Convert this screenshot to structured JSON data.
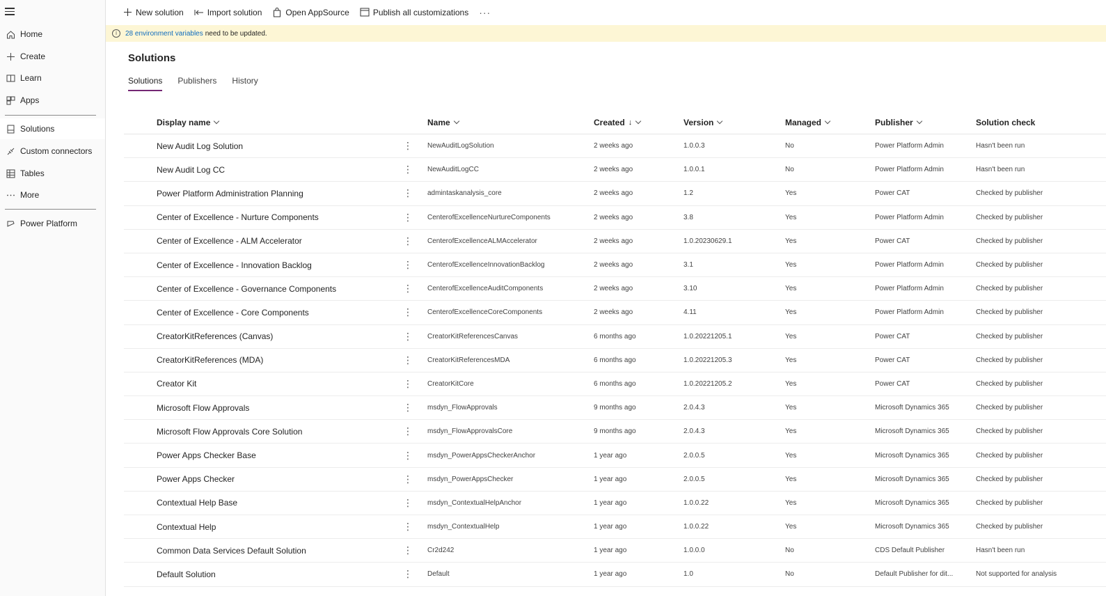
{
  "sidebar": {
    "items": [
      {
        "label": "Home",
        "icon": "home-icon"
      },
      {
        "label": "Create",
        "icon": "plus-icon"
      },
      {
        "label": "Learn",
        "icon": "book-icon"
      },
      {
        "label": "Apps",
        "icon": "apps-icon"
      },
      {
        "label": "Solutions",
        "icon": "solutions-icon"
      },
      {
        "label": "Custom connectors",
        "icon": "connector-icon"
      },
      {
        "label": "Tables",
        "icon": "table-icon"
      },
      {
        "label": "More",
        "icon": "more-icon"
      },
      {
        "label": "Power Platform",
        "icon": "power-platform-icon"
      }
    ],
    "active": "Solutions"
  },
  "commands": {
    "new_solution": "New solution",
    "import_solution": "Import solution",
    "open_appsource": "Open AppSource",
    "publish_all": "Publish all customizations",
    "more": "···"
  },
  "banner": {
    "link": "28 environment variables",
    "text": "need to be updated."
  },
  "page": {
    "title": "Solutions",
    "tabs": [
      "Solutions",
      "Publishers",
      "History"
    ]
  },
  "grid": {
    "headers": {
      "display_name": "Display name",
      "name": "Name",
      "created": "Created",
      "version": "Version",
      "managed": "Managed",
      "publisher": "Publisher",
      "solution_check": "Solution check"
    },
    "rows": [
      {
        "display": "New Audit Log Solution",
        "name": "NewAuditLogSolution",
        "created": "2 weeks ago",
        "version": "1.0.0.3",
        "managed": "No",
        "publisher": "Power Platform Admin",
        "check": "Hasn't been run"
      },
      {
        "display": "New Audit Log CC",
        "name": "NewAuditLogCC",
        "created": "2 weeks ago",
        "version": "1.0.0.1",
        "managed": "No",
        "publisher": "Power Platform Admin",
        "check": "Hasn't been run"
      },
      {
        "display": "Power Platform Administration Planning",
        "name": "admintaskanalysis_core",
        "created": "2 weeks ago",
        "version": "1.2",
        "managed": "Yes",
        "publisher": "Power CAT",
        "check": "Checked by publisher"
      },
      {
        "display": "Center of Excellence - Nurture Components",
        "name": "CenterofExcellenceNurtureComponents",
        "created": "2 weeks ago",
        "version": "3.8",
        "managed": "Yes",
        "publisher": "Power Platform Admin",
        "check": "Checked by publisher"
      },
      {
        "display": "Center of Excellence - ALM Accelerator",
        "name": "CenterofExcellenceALMAccelerator",
        "created": "2 weeks ago",
        "version": "1.0.20230629.1",
        "managed": "Yes",
        "publisher": "Power CAT",
        "check": "Checked by publisher"
      },
      {
        "display": "Center of Excellence - Innovation Backlog",
        "name": "CenterofExcellenceInnovationBacklog",
        "created": "2 weeks ago",
        "version": "3.1",
        "managed": "Yes",
        "publisher": "Power Platform Admin",
        "check": "Checked by publisher"
      },
      {
        "display": "Center of Excellence - Governance Components",
        "name": "CenterofExcellenceAuditComponents",
        "created": "2 weeks ago",
        "version": "3.10",
        "managed": "Yes",
        "publisher": "Power Platform Admin",
        "check": "Checked by publisher"
      },
      {
        "display": "Center of Excellence - Core Components",
        "name": "CenterofExcellenceCoreComponents",
        "created": "2 weeks ago",
        "version": "4.11",
        "managed": "Yes",
        "publisher": "Power Platform Admin",
        "check": "Checked by publisher"
      },
      {
        "display": "CreatorKitReferences (Canvas)",
        "name": "CreatorKitReferencesCanvas",
        "created": "6 months ago",
        "version": "1.0.20221205.1",
        "managed": "Yes",
        "publisher": "Power CAT",
        "check": "Checked by publisher"
      },
      {
        "display": "CreatorKitReferences (MDA)",
        "name": "CreatorKitReferencesMDA",
        "created": "6 months ago",
        "version": "1.0.20221205.3",
        "managed": "Yes",
        "publisher": "Power CAT",
        "check": "Checked by publisher"
      },
      {
        "display": "Creator Kit",
        "name": "CreatorKitCore",
        "created": "6 months ago",
        "version": "1.0.20221205.2",
        "managed": "Yes",
        "publisher": "Power CAT",
        "check": "Checked by publisher"
      },
      {
        "display": "Microsoft Flow Approvals",
        "name": "msdyn_FlowApprovals",
        "created": "9 months ago",
        "version": "2.0.4.3",
        "managed": "Yes",
        "publisher": "Microsoft Dynamics 365",
        "check": "Checked by publisher"
      },
      {
        "display": "Microsoft Flow Approvals Core Solution",
        "name": "msdyn_FlowApprovalsCore",
        "created": "9 months ago",
        "version": "2.0.4.3",
        "managed": "Yes",
        "publisher": "Microsoft Dynamics 365",
        "check": "Checked by publisher"
      },
      {
        "display": "Power Apps Checker Base",
        "name": "msdyn_PowerAppsCheckerAnchor",
        "created": "1 year ago",
        "version": "2.0.0.5",
        "managed": "Yes",
        "publisher": "Microsoft Dynamics 365",
        "check": "Checked by publisher"
      },
      {
        "display": "Power Apps Checker",
        "name": "msdyn_PowerAppsChecker",
        "created": "1 year ago",
        "version": "2.0.0.5",
        "managed": "Yes",
        "publisher": "Microsoft Dynamics 365",
        "check": "Checked by publisher"
      },
      {
        "display": "Contextual Help Base",
        "name": "msdyn_ContextualHelpAnchor",
        "created": "1 year ago",
        "version": "1.0.0.22",
        "managed": "Yes",
        "publisher": "Microsoft Dynamics 365",
        "check": "Checked by publisher"
      },
      {
        "display": "Contextual Help",
        "name": "msdyn_ContextualHelp",
        "created": "1 year ago",
        "version": "1.0.0.22",
        "managed": "Yes",
        "publisher": "Microsoft Dynamics 365",
        "check": "Checked by publisher"
      },
      {
        "display": "Common Data Services Default Solution",
        "name": "Cr2d242",
        "created": "1 year ago",
        "version": "1.0.0.0",
        "managed": "No",
        "publisher": "CDS Default Publisher",
        "check": "Hasn't been run"
      },
      {
        "display": "Default Solution",
        "name": "Default",
        "created": "1 year ago",
        "version": "1.0",
        "managed": "No",
        "publisher": "Default Publisher for dit...",
        "check": "Not supported for analysis"
      }
    ]
  },
  "colors": {
    "accent": "#742774",
    "link": "#0f6cbd",
    "banner_bg": "#fdf6d5"
  }
}
